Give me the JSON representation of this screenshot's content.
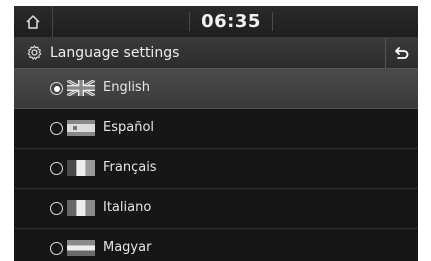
{
  "status": {
    "time": "06:35"
  },
  "header": {
    "title": "Language settings"
  },
  "languages": [
    {
      "label": "English",
      "flag": "uk-flag-icon",
      "selected": true
    },
    {
      "label": "Español",
      "flag": "spain-flag-icon",
      "selected": false
    },
    {
      "label": "Français",
      "flag": "france-flag-icon",
      "selected": false
    },
    {
      "label": "Italiano",
      "flag": "italy-flag-icon",
      "selected": false
    },
    {
      "label": "Magyar",
      "flag": "hungary-flag-icon",
      "selected": false
    }
  ],
  "colors": {
    "screen_bg": "#1a1a1a",
    "selected_row": "#444444",
    "text": "#e6e6e6"
  }
}
